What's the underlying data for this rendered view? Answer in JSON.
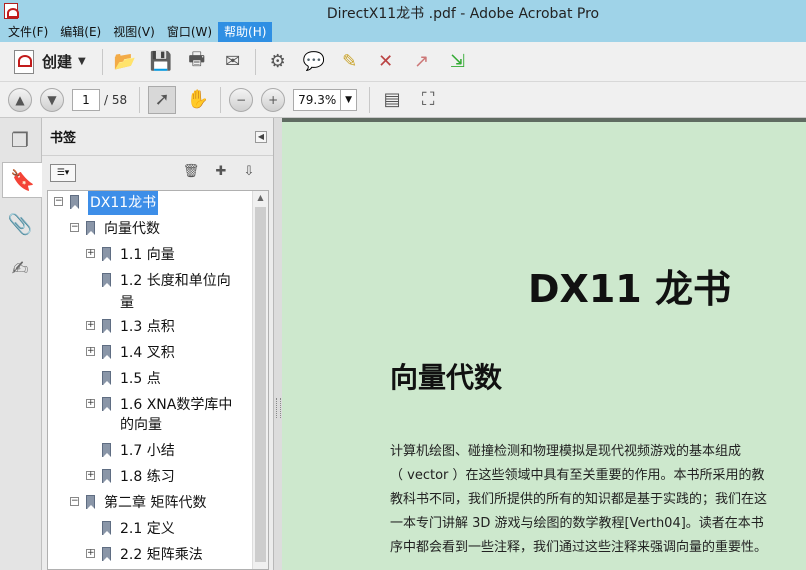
{
  "window": {
    "title": "DirectX11龙书 .pdf - Adobe Acrobat Pro"
  },
  "menu": [
    "文件(F)",
    "编辑(E)",
    "视图(V)",
    "窗口(W)",
    "帮助(H)"
  ],
  "toolbar": {
    "create_label": "创建",
    "page_current": "1",
    "page_total": "/ 58",
    "zoom": "79.3%"
  },
  "panel": {
    "title": "书签"
  },
  "bookmarks": [
    {
      "label": "DX11龙书",
      "selected": true
    },
    {
      "label": "向量代数"
    },
    {
      "label": "1.1 向量"
    },
    {
      "label": "1.2 长度和单位向",
      "label2": "量"
    },
    {
      "label": "1.3 点积"
    },
    {
      "label": "1.4 叉积"
    },
    {
      "label": "1.5 点"
    },
    {
      "label": "1.6 XNA数学库中",
      "label2": "的向量"
    },
    {
      "label": "1.7 小结"
    },
    {
      "label": "1.8 练习"
    },
    {
      "label": "第二章 矩阵代数"
    },
    {
      "label": "2.1 定义"
    },
    {
      "label": "2.2 矩阵乘法"
    }
  ],
  "document": {
    "title": "DX11 龙书",
    "heading": "向量代数",
    "paragraph": [
      "计算机绘图、碰撞检测和物理模拟是现代视频游戏的基本组成",
      "（ vector ）在这些领域中具有至关重要的作用。本书所采用的教",
      "教科书不同，我们所提供的所有的知识都是基于实践的；我们在这",
      "一本专门讲解 3D 游戏与绘图的数学教程[Verth04]。读者在本书",
      "序中都会看到一些注释，我们通过这些注释来强调向量的重要性。"
    ]
  }
}
